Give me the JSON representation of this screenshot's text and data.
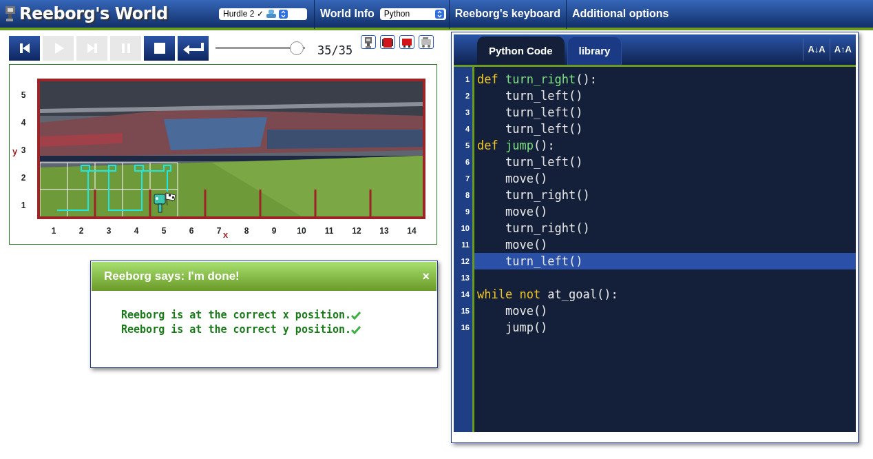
{
  "navbar": {
    "logo": "Reeborg's World",
    "world_select": {
      "value": "Hurdle 2 ✓"
    },
    "menu": [
      {
        "kind": "link",
        "label": "World Info"
      },
      {
        "kind": "select",
        "label": "Python"
      },
      {
        "kind": "link",
        "label": "Reeborg's keyboard"
      },
      {
        "kind": "link",
        "label": "Additional options"
      }
    ]
  },
  "controls": {
    "buttons": [
      {
        "kind": "reload",
        "disabled": false
      },
      {
        "kind": "run",
        "disabled": true
      },
      {
        "kind": "step",
        "disabled": true
      },
      {
        "kind": "pause",
        "disabled": true
      },
      {
        "kind": "stop",
        "disabled": false
      },
      {
        "kind": "return",
        "disabled": false
      }
    ],
    "slider": {
      "level": 1
    },
    "step_count": "35/35"
  },
  "world": {
    "x_labels": [
      "1",
      "2",
      "3",
      "4",
      "5",
      "6",
      "7",
      "8",
      "9",
      "10",
      "11",
      "12",
      "13",
      "14"
    ],
    "y_labels": [
      "5",
      "4",
      "3",
      "2",
      "1"
    ],
    "x_axis": "x",
    "y_axis": "y"
  },
  "dialog": {
    "title": "Reeborg says: I'm done!",
    "close": "×",
    "messages": [
      "Reeborg is at the correct x position.",
      "Reeborg is at the correct y position."
    ]
  },
  "editor": {
    "tabs": [
      {
        "label": "Python Code",
        "selected": true
      },
      {
        "label": "library",
        "selected": false
      }
    ],
    "font_buttons": [
      "A↓A",
      "A↑A"
    ],
    "lines": [
      {
        "number": "1",
        "selected": false,
        "tokens": [
          {
            "kind": "keyword",
            "text": "def "
          },
          {
            "kind": "defname",
            "text": "turn_right"
          },
          {
            "kind": "plain",
            "text": "():"
          }
        ]
      },
      {
        "number": "2",
        "selected": false,
        "tokens": [
          {
            "kind": "plain",
            "text": "    turn_left()"
          }
        ]
      },
      {
        "number": "3",
        "selected": false,
        "tokens": [
          {
            "kind": "plain",
            "text": "    turn_left()"
          }
        ]
      },
      {
        "number": "4",
        "selected": false,
        "tokens": [
          {
            "kind": "plain",
            "text": "    turn_left()"
          }
        ]
      },
      {
        "number": "5",
        "selected": false,
        "tokens": [
          {
            "kind": "keyword",
            "text": "def "
          },
          {
            "kind": "defname",
            "text": "jump"
          },
          {
            "kind": "plain",
            "text": "():"
          }
        ]
      },
      {
        "number": "6",
        "selected": false,
        "tokens": [
          {
            "kind": "plain",
            "text": "    turn_left()"
          }
        ]
      },
      {
        "number": "7",
        "selected": false,
        "tokens": [
          {
            "kind": "plain",
            "text": "    move()"
          }
        ]
      },
      {
        "number": "8",
        "selected": false,
        "tokens": [
          {
            "kind": "plain",
            "text": "    turn_right()"
          }
        ]
      },
      {
        "number": "9",
        "selected": false,
        "tokens": [
          {
            "kind": "plain",
            "text": "    move()"
          }
        ]
      },
      {
        "number": "10",
        "selected": false,
        "tokens": [
          {
            "kind": "plain",
            "text": "    turn_right()"
          }
        ]
      },
      {
        "number": "11",
        "selected": false,
        "tokens": [
          {
            "kind": "plain",
            "text": "    move()"
          }
        ]
      },
      {
        "number": "12",
        "selected": true,
        "tokens": [
          {
            "kind": "plain",
            "text": "    turn_left()"
          }
        ]
      },
      {
        "number": "13",
        "selected": false
      },
      {
        "number": "14",
        "selected": false,
        "tokens": [
          {
            "kind": "keyword",
            "text": "while not"
          },
          {
            "kind": "plain",
            "text": " at_goal():"
          }
        ]
      },
      {
        "number": "15",
        "selected": false,
        "tokens": [
          {
            "kind": "plain",
            "text": "    move()"
          }
        ]
      },
      {
        "number": "16",
        "selected": false,
        "tokens": [
          {
            "kind": "plain",
            "text": "    jump()"
          }
        ]
      }
    ]
  }
}
